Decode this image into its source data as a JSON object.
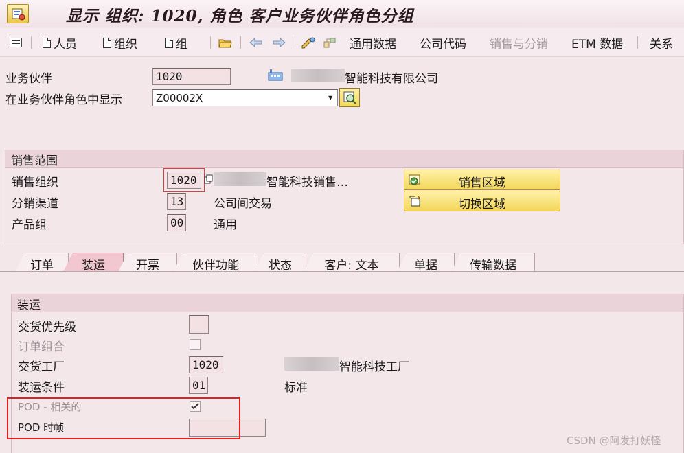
{
  "window": {
    "title": "显示 组织: 1020, 角色 客户业务伙伴角色分组",
    "app_icon": "sap-transaction-icon"
  },
  "toolbar": {
    "items": [
      {
        "label": "",
        "icon": "overview-icon"
      },
      {
        "label": "人员",
        "icon": "document-icon"
      },
      {
        "label": "组织",
        "icon": "document-icon"
      },
      {
        "label": "组",
        "icon": "document-icon"
      },
      {
        "label": "",
        "icon": "open-folder-icon"
      },
      {
        "label": "",
        "icon": "arrow-left-icon"
      },
      {
        "label": "",
        "icon": "arrow-right-icon"
      },
      {
        "label": "",
        "icon": "edit-display-icon"
      },
      {
        "label": "",
        "icon": "where-used-icon"
      },
      {
        "label": "通用数据",
        "icon": ""
      },
      {
        "label": "公司代码",
        "icon": ""
      },
      {
        "label": "销售与分销",
        "icon": "",
        "disabled": true
      },
      {
        "label": "ETM 数据",
        "icon": ""
      },
      {
        "label": "关系",
        "icon": ""
      }
    ]
  },
  "header": {
    "bp_label": "业务伙伴",
    "bp_value": "1020",
    "bp_name": "智能科技有限公司",
    "role_label": "在业务伙伴角色中显示",
    "role_value": "Z00002X"
  },
  "sales_area": {
    "title": "销售范围",
    "sales_org_label": "销售组织",
    "sales_org_value": "1020",
    "sales_org_desc": "智能科技销售…",
    "dist_channel_label": "分销渠道",
    "dist_channel_value": "13",
    "dist_channel_desc": "公司间交易",
    "division_label": "产品组",
    "division_value": "00",
    "division_desc": "通用",
    "btn_sales_areas": "销售区域",
    "btn_switch_area": "切换区域"
  },
  "tabs": [
    {
      "label": "订单",
      "active": false
    },
    {
      "label": "装运",
      "active": true
    },
    {
      "label": "开票",
      "active": false
    },
    {
      "label": "伙伴功能",
      "active": false
    },
    {
      "label": "状态",
      "active": false
    },
    {
      "label": "客户: 文本",
      "active": false
    },
    {
      "label": "单据",
      "active": false
    },
    {
      "label": "传输数据",
      "active": false
    }
  ],
  "shipping": {
    "title": "装运",
    "delivery_priority_label": "交货优先级",
    "delivery_priority_value": "",
    "order_combination_label": "订单组合",
    "order_combination_checked": false,
    "delivering_plant_label": "交货工厂",
    "delivering_plant_value": "1020",
    "delivering_plant_desc": "智能科技工厂",
    "shipping_cond_label": "装运条件",
    "shipping_cond_value": "01",
    "shipping_cond_desc": "标准",
    "pod_relevant_label": "POD - 相关的",
    "pod_relevant_checked": true,
    "pod_timeframe_label": "POD 时帧",
    "pod_timeframe_value": ""
  },
  "watermark": "CSDN @阿发打妖怪",
  "colors": {
    "background": "#f3e7ea",
    "highlight": "#e3201d",
    "button": "#f3d75a"
  }
}
